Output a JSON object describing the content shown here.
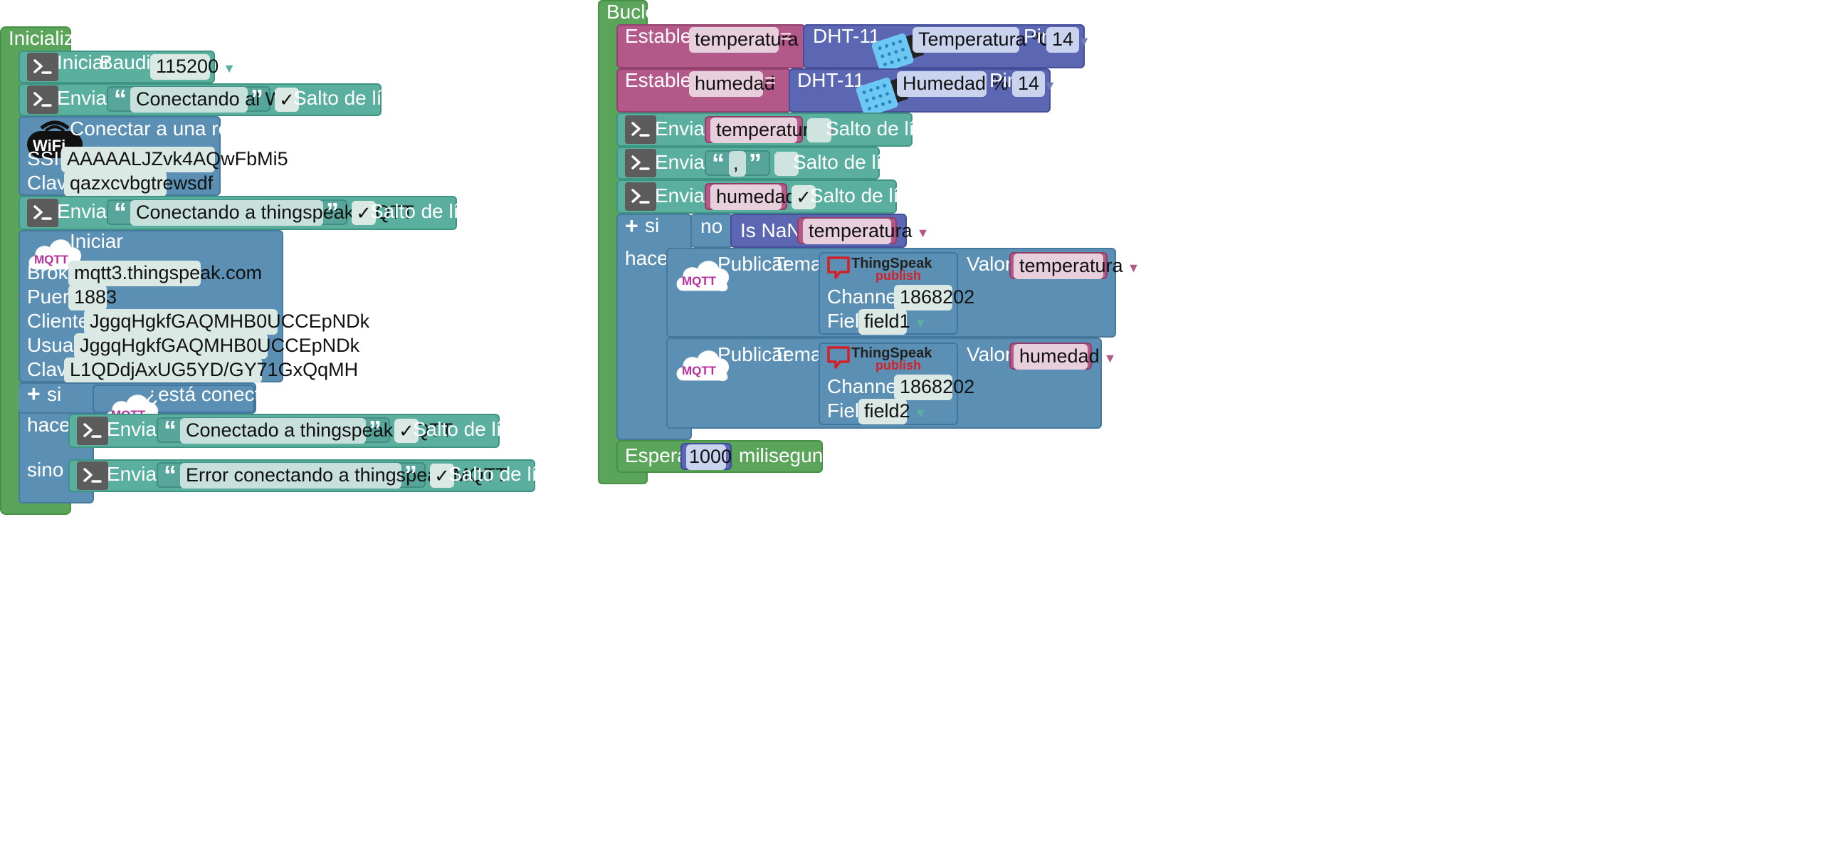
{
  "setup": {
    "title": "Inicializar",
    "serial_begin": {
      "label": "Iniciar",
      "baud_label": "Baudios",
      "baud_value": "115200"
    },
    "send1": {
      "label": "Enviar",
      "text": "Conectando al Wifi",
      "newline_label": "Salto de línea",
      "newline_checked": "✓"
    },
    "wifi": {
      "title": "Conectar a una red WiFi",
      "ssid_label": "SSID",
      "ssid_value": "AAAAALJZvk4AQwFbMi5",
      "key_label": "Clave",
      "key_value": "qazxcvbgtrewsdf"
    },
    "send2": {
      "label": "Enviar",
      "text": "Conectando a thingspeak MQTT",
      "newline_label": "Salto de línea",
      "newline_checked": "✓"
    },
    "mqtt": {
      "title": "Iniciar",
      "broker_label": "Broker",
      "broker_value": "mqtt3.thingspeak.com",
      "port_label": "Puerto",
      "port_value": "1883",
      "client_label": "Cliente Id",
      "client_value": "JggqHgkfGAQMHB0UCCEpNDk",
      "user_label": "Usuario",
      "user_value": "JggqHgkfGAQMHB0UCCEpNDk",
      "pass_label": "Clave",
      "pass_value": "L1QDdjAxUG5YD/GY71GxQqMH"
    },
    "if_block": {
      "if_label": "si",
      "condition": "¿está conectado?",
      "do_label": "hacer",
      "else_label": "sino",
      "send_ok": {
        "label": "Enviar",
        "text": "Conectado a thingspeak MQTT",
        "newline_label": "Salto de línea",
        "newline_checked": "✓"
      },
      "send_err": {
        "label": "Enviar",
        "text": "Error conectando a thingspeak MQTT",
        "newline_label": "Salto de línea",
        "newline_checked": "✓"
      }
    }
  },
  "loop": {
    "title": "Bucle",
    "set_temp": {
      "label": "Establecer",
      "var": "temperatura",
      "eq": "=",
      "sensor": "DHT-11",
      "measure": "Temperatura ºC",
      "pin_label": "Pin",
      "pin": "14"
    },
    "set_hum": {
      "label": "Establecer",
      "var": "humedad",
      "eq": "=",
      "sensor": "DHT-11",
      "measure": "Humedad %",
      "pin_label": "Pin",
      "pin": "14"
    },
    "send_temp": {
      "label": "Enviar",
      "var": "temperatura",
      "newline_label": "Salto de línea"
    },
    "send_comma": {
      "label": "Enviar",
      "text": ",",
      "newline_label": "Salto de línea"
    },
    "send_hum": {
      "label": "Enviar",
      "var": "humedad",
      "newline_label": "Salto de línea",
      "newline_checked": "✓"
    },
    "if_block": {
      "if_label": "si",
      "not_label": "no",
      "isnan_label": "Is NaN?",
      "isnan_var": "temperatura",
      "do_label": "hacer",
      "pub1": {
        "label": "Publicar",
        "topic_label": "Tema",
        "logo_main": "ThingSpeak",
        "logo_sub": "publish",
        "channel_label": "Channel ID",
        "channel": "1868202",
        "field_label": "Field",
        "field": "field1",
        "value_label": "Valor",
        "value_var": "temperatura"
      },
      "pub2": {
        "label": "Publicar",
        "topic_label": "Tema",
        "logo_main": "ThingSpeak",
        "logo_sub": "publish",
        "channel_label": "Channel ID",
        "channel": "1868202",
        "field_label": "Field",
        "field": "field2",
        "value_label": "Valor",
        "value_var": "humedad"
      }
    },
    "wait": {
      "label": "Esperar",
      "value": "1000",
      "unit": "milisegundos"
    }
  },
  "icons": {
    "terminal": "terminal-icon",
    "mqtt": "mqtt-cloud-icon",
    "wifi": "wifi-icon",
    "thingspeak": "thingspeak-logo",
    "dht": "dht11-sensor-icon",
    "dropdown": "dropdown-arrow-icon"
  },
  "mqtt_icon_text": "MQTT",
  "wifi_icon_text": "WiFi",
  "colors": {
    "event": "#5ba55a",
    "serial": "#5baf9f",
    "network": "#5b8fb3",
    "variable": "#b3598a",
    "logic": "#5b67b3"
  }
}
